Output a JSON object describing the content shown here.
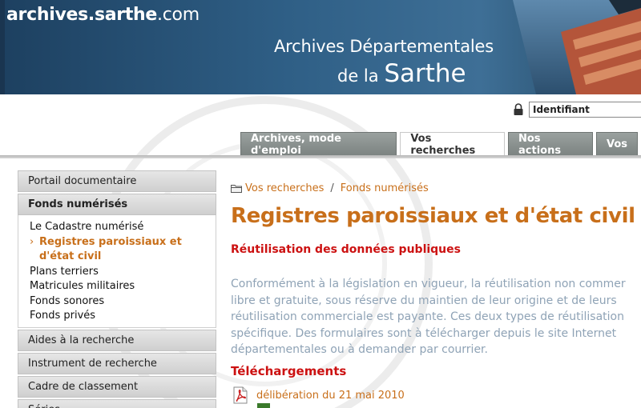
{
  "header": {
    "domain_bold": "archives.sarthe",
    "domain_rest": ".com",
    "title_line1": "Archives Départementales",
    "title_line2_small": "de la ",
    "title_line2_big": "Sarthe"
  },
  "login": {
    "value": "Identifiant"
  },
  "tabs": [
    {
      "label": "Archives, mode d'emploi"
    },
    {
      "label": "Vos recherches"
    },
    {
      "label": "Nos actions"
    },
    {
      "label": "Vos"
    }
  ],
  "sidebar": {
    "portail": "Portail documentaire",
    "fonds": "Fonds numérisés",
    "fonds_items": [
      "Le Cadastre numérisé",
      "Registres paroissiaux et d'état civil",
      "Plans terriers",
      "Matricules militaires",
      "Fonds sonores",
      "Fonds privés"
    ],
    "current_line1": "Registres paroissiaux et",
    "current_line2": "d'état civil",
    "aides": "Aides à la recherche",
    "instrument": "Instrument de recherche",
    "cadre": "Cadre de classement",
    "series": "Séries"
  },
  "breadcrumb": {
    "item1": "Vos recherches",
    "separator": "/",
    "item2": "Fonds numérisés"
  },
  "main": {
    "title": "Registres paroissiaux et d'état civil",
    "subtitle": "Réutilisation des données publiques",
    "paragraph": "Conformément à la législation en vigueur, la réutilisation non commer\nlibre et gratuite, sous réserve du maintien de leur origine et de leurs\nréutilisation commerciale est payante. Ces deux types de réutilisation\nspécifique. Des formulaires sont à télécharger depuis le site Internet\ndépartementales ou à demander par courrier.",
    "downloads_title": "Téléchargements",
    "download1": "délibération du 21 mai 2010"
  },
  "colors": {
    "orange": "#c86f1a",
    "red": "#cc1111",
    "header_blue": "#2c5577"
  }
}
